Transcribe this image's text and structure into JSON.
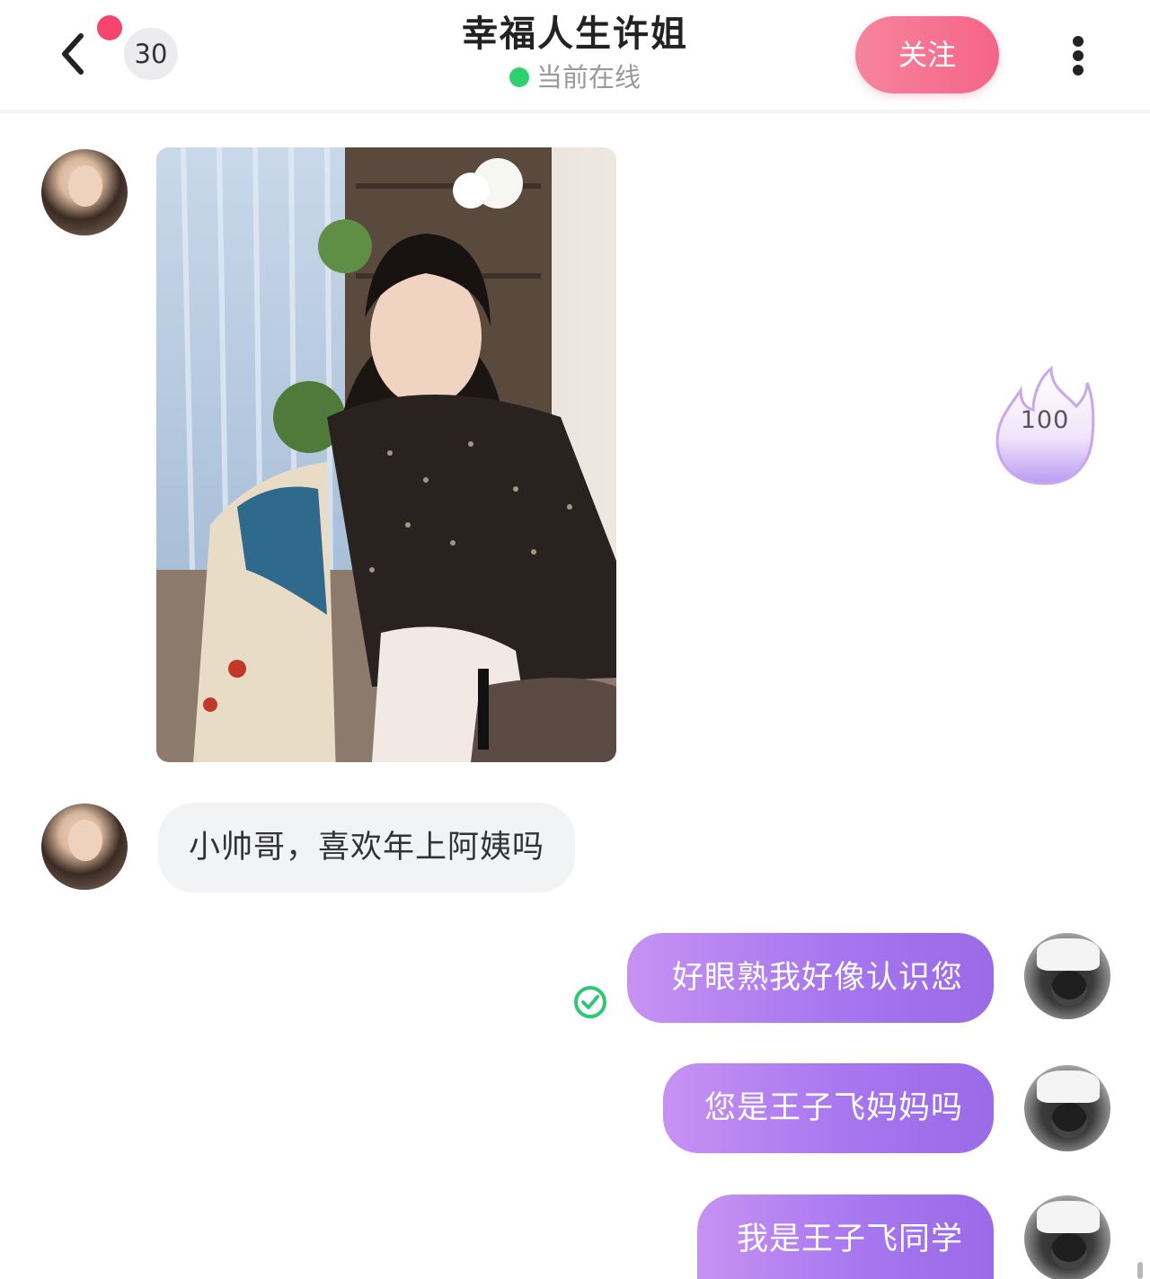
{
  "header": {
    "unread_count": "30",
    "title": "幸福人生许姐",
    "status": "当前在线",
    "follow_label": "关注",
    "colors": {
      "follow": "#f66488",
      "online": "#2fd06e",
      "unread_dot": "#f5456f"
    }
  },
  "icons": {
    "back": "chevron-left-icon",
    "more": "more-vertical-icon",
    "read": "check-circle-icon",
    "gift": "flame-icon"
  },
  "messages": [
    {
      "from": "them",
      "type": "image"
    },
    {
      "from": "them",
      "type": "text",
      "text": "小帅哥，喜欢年上阿姨吗"
    },
    {
      "from": "me",
      "type": "text",
      "text": "好眼熟我好像认识您",
      "read": true
    },
    {
      "from": "me",
      "type": "text",
      "text": "您是王子飞妈妈吗"
    },
    {
      "from": "me",
      "type": "text",
      "text": "我是王子飞同学"
    }
  ],
  "gift": {
    "value": "100"
  },
  "colors": {
    "bubble_out": "#a777ef",
    "bubble_in": "#f2f3f5"
  }
}
